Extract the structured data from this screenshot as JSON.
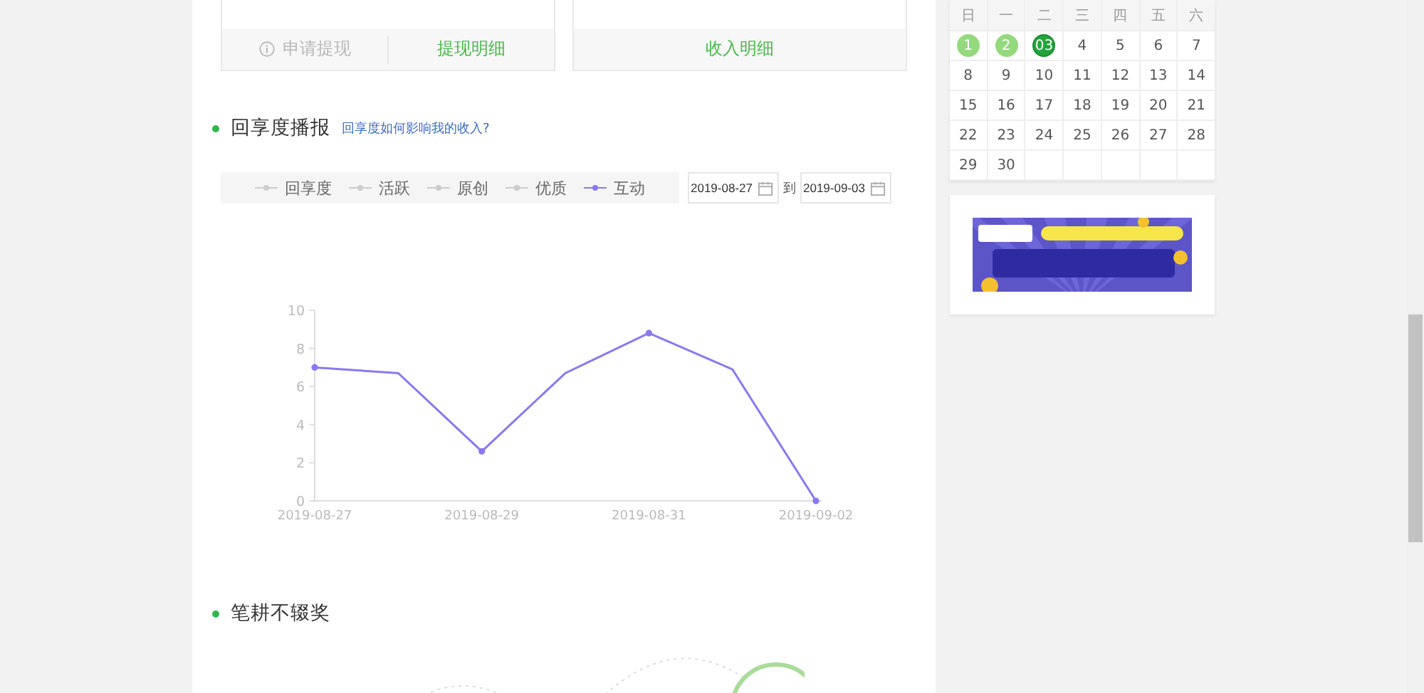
{
  "top_cards": [
    {
      "actions": [
        {
          "label": "申请提现",
          "disabled": true
        },
        {
          "label": "提现明细",
          "disabled": false
        }
      ]
    },
    {
      "actions": [
        {
          "label": "收入明细",
          "disabled": false
        }
      ]
    }
  ],
  "broadcast": {
    "title": "回享度播报",
    "help_link": "回享度如何影响我的收入?",
    "legend": [
      {
        "label": "回享度",
        "selected": false
      },
      {
        "label": "活跃",
        "selected": false
      },
      {
        "label": "原创",
        "selected": false
      },
      {
        "label": "优质",
        "selected": false
      },
      {
        "label": "互动",
        "selected": true
      }
    ],
    "date_from": "2019-08-27",
    "date_sep": "到",
    "date_to": "2019-09-03",
    "chart_data": {
      "type": "line",
      "categories": [
        "2019-08-27",
        null,
        "2019-08-29",
        null,
        "2019-08-31",
        null,
        "2019-09-02"
      ],
      "series": [
        {
          "color": "#8b78f0",
          "values": [
            7.0,
            6.7,
            2.6,
            6.7,
            8.8,
            6.9,
            0
          ]
        }
      ],
      "ylim": [
        0,
        10
      ],
      "yticks": [
        0,
        2,
        4,
        6,
        8,
        10
      ]
    }
  },
  "section2": {
    "title": "笔耕不辍奖"
  },
  "calendar": {
    "weekdays": [
      "日",
      "一",
      "二",
      "三",
      "四",
      "五",
      "六"
    ],
    "days": [
      {
        "label": "1",
        "checked": true,
        "today": false
      },
      {
        "label": "2",
        "checked": true,
        "today": false
      },
      {
        "label": "03",
        "checked": true,
        "today": true
      },
      {
        "label": "4",
        "checked": false,
        "today": false
      },
      {
        "label": "5",
        "checked": false,
        "today": false
      },
      {
        "label": "6",
        "checked": false,
        "today": false
      },
      {
        "label": "7",
        "checked": false,
        "today": false
      },
      {
        "label": "8",
        "checked": false,
        "today": false
      },
      {
        "label": "9",
        "checked": false,
        "today": false
      },
      {
        "label": "10",
        "checked": false,
        "today": false
      },
      {
        "label": "11",
        "checked": false,
        "today": false
      },
      {
        "label": "12",
        "checked": false,
        "today": false
      },
      {
        "label": "13",
        "checked": false,
        "today": false
      },
      {
        "label": "14",
        "checked": false,
        "today": false
      },
      {
        "label": "15",
        "checked": false,
        "today": false
      },
      {
        "label": "16",
        "checked": false,
        "today": false
      },
      {
        "label": "17",
        "checked": false,
        "today": false
      },
      {
        "label": "18",
        "checked": false,
        "today": false
      },
      {
        "label": "19",
        "checked": false,
        "today": false
      },
      {
        "label": "20",
        "checked": false,
        "today": false
      },
      {
        "label": "21",
        "checked": false,
        "today": false
      },
      {
        "label": "22",
        "checked": false,
        "today": false
      },
      {
        "label": "23",
        "checked": false,
        "today": false
      },
      {
        "label": "24",
        "checked": false,
        "today": false
      },
      {
        "label": "25",
        "checked": false,
        "today": false
      },
      {
        "label": "26",
        "checked": false,
        "today": false
      },
      {
        "label": "27",
        "checked": false,
        "today": false
      },
      {
        "label": "28",
        "checked": false,
        "today": false
      },
      {
        "label": "29",
        "checked": false,
        "today": false
      },
      {
        "label": "30",
        "checked": false,
        "today": false
      }
    ]
  }
}
